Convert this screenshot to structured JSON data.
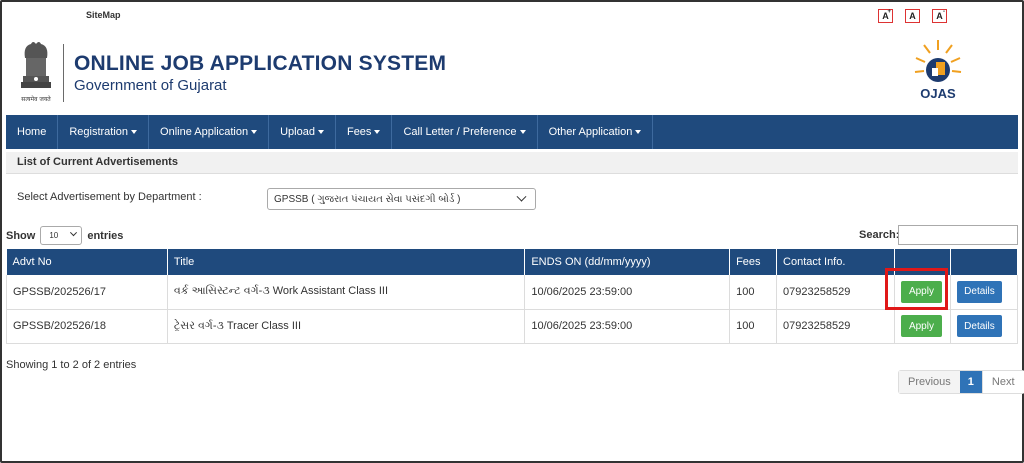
{
  "header": {
    "sitemap": "SiteMap",
    "font_buttons": [
      "A",
      "A",
      "A"
    ],
    "font_button_marks": [
      "+",
      "",
      "-"
    ],
    "emblem_motto": "सत्यमेव जयते",
    "title": "ONLINE JOB APPLICATION SYSTEM",
    "subtitle": "Government of Gujarat",
    "logo_text": "OJAS"
  },
  "nav": {
    "items": [
      {
        "label": "Home",
        "caret": false
      },
      {
        "label": "Registration",
        "caret": true
      },
      {
        "label": "Online Application",
        "caret": true
      },
      {
        "label": "Upload",
        "caret": true
      },
      {
        "label": "Fees",
        "caret": true
      },
      {
        "label": "Call Letter / Preference",
        "caret": true
      },
      {
        "label": "Other Application",
        "caret": true
      }
    ]
  },
  "panel": {
    "title": "List of Current Advertisements",
    "select_label": "Select Advertisement by Department :",
    "department_selected": "GPSSB ( ગુજરાત પંચાયત સેવા પસંદગી બોર્ડ )"
  },
  "table_controls": {
    "show_label": "Show",
    "entries_value": "10",
    "entries_label": "entries",
    "search_label": "Search:"
  },
  "table": {
    "headers": [
      "Advt No",
      "Title",
      "ENDS ON (dd/mm/yyyy)",
      "Fees",
      "Contact Info.",
      "",
      ""
    ],
    "rows": [
      {
        "advt_no": "GPSSB/202526/17",
        "title": "વર્ક આસિસ્ટન્ટ વર્ગ-૩ Work Assistant Class III",
        "ends_on": "10/06/2025 23:59:00",
        "fees": "100",
        "contact": "07923258529",
        "apply": "Apply",
        "details": "Details"
      },
      {
        "advt_no": "GPSSB/202526/18",
        "title": "ટ્રેસર વર્ગ-૩ Tracer Class III",
        "ends_on": "10/06/2025 23:59:00",
        "fees": "100",
        "contact": "07923258529",
        "apply": "Apply",
        "details": "Details"
      }
    ]
  },
  "footer": {
    "info": "Showing 1 to 2 of 2 entries",
    "previous": "Previous",
    "page": "1",
    "next": "Next"
  },
  "colors": {
    "nav_bg": "#1f4a7d",
    "apply_green": "#4cae4c",
    "details_blue": "#2f73b7",
    "highlight_red": "#e01818"
  }
}
